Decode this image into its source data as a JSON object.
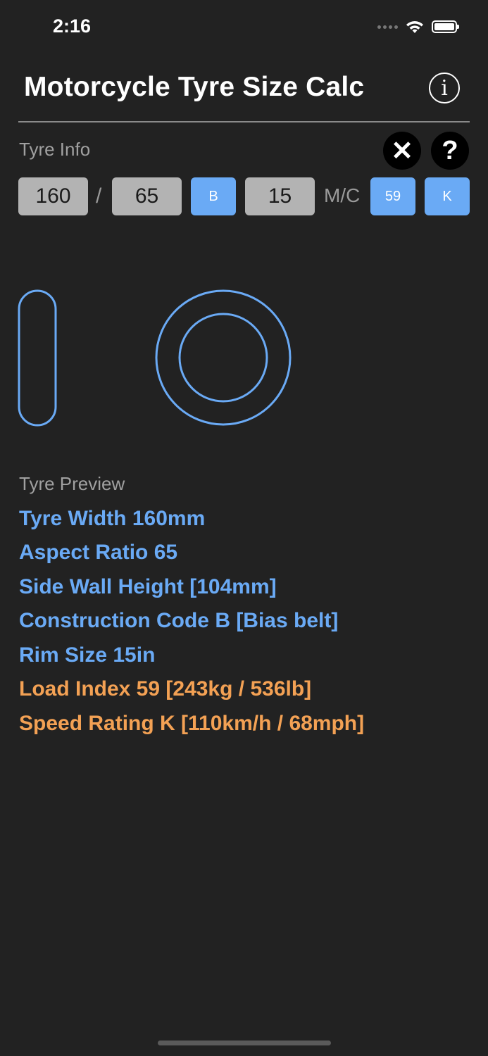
{
  "status": {
    "time": "2:16"
  },
  "header": {
    "title": "Motorcycle Tyre Size Calc",
    "info_glyph": "i"
  },
  "tyre_info": {
    "label": "Tyre Info",
    "clear_glyph": "✕",
    "help_glyph": "?",
    "width": "160",
    "slash": "/",
    "aspect": "65",
    "construction": "B",
    "rim": "15",
    "mc_label": "M/C",
    "load_index": "59",
    "speed_rating": "K"
  },
  "preview": {
    "label": "Tyre Preview",
    "lines": [
      "Tyre Width 160mm",
      "Aspect Ratio 65",
      "Side Wall Height [104mm]",
      "Construction Code B [Bias belt]",
      "Rim Size 15in",
      "Load Index 59 [243kg / 536lb]",
      "Speed Rating K [110km/h / 68mph]"
    ]
  },
  "colors": {
    "background": "#222222",
    "accent_blue": "#6aaaf5",
    "accent_orange": "#f3a154",
    "field_grey": "#b3b3b3"
  }
}
